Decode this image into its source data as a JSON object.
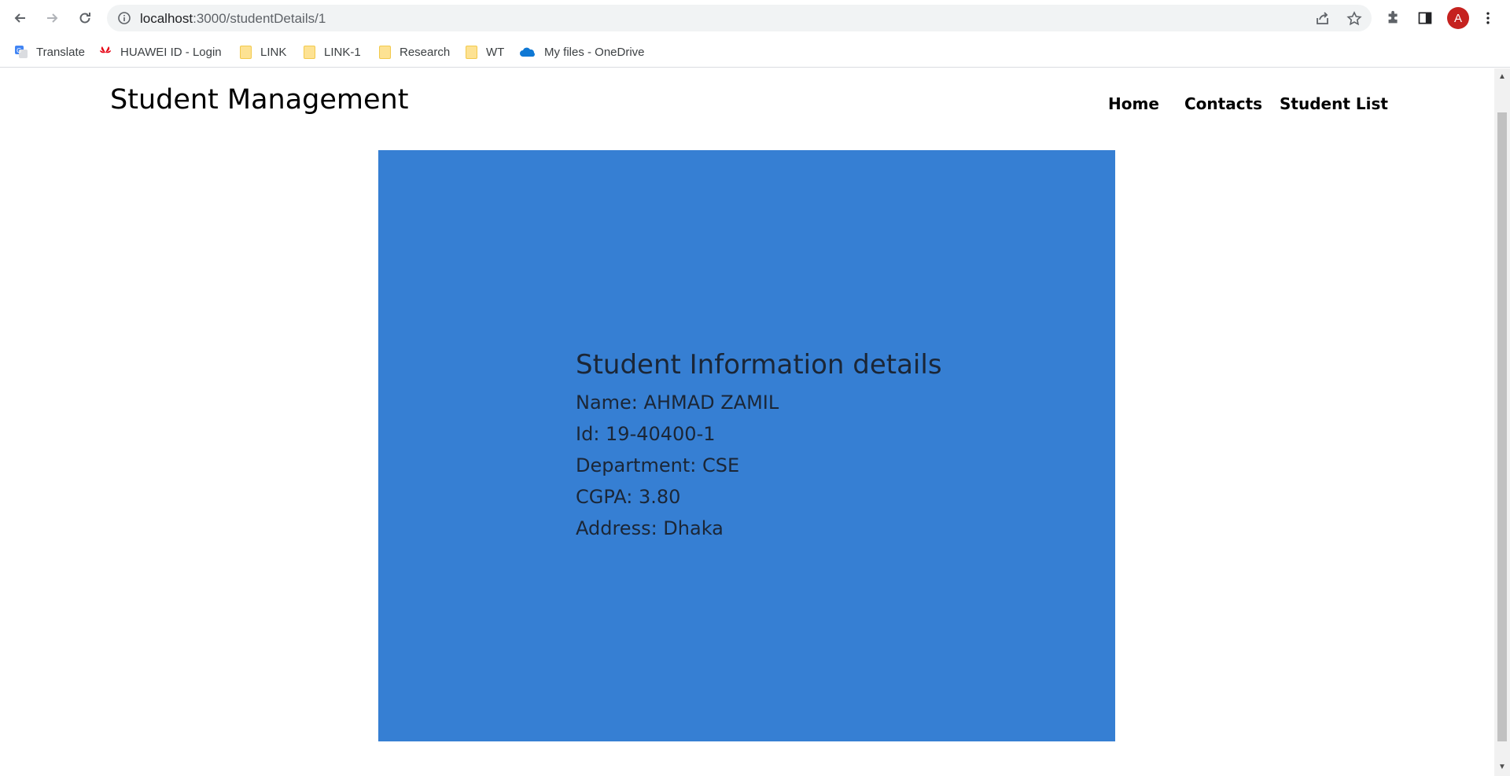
{
  "browser": {
    "url_host": "localhost",
    "url_path": ":3000/studentDetails/1",
    "profile_initial": "A",
    "icons": {
      "back": "arrow-left-icon",
      "forward": "arrow-right-icon",
      "reload": "reload-icon",
      "info": "info-icon",
      "share": "share-icon",
      "bookmark": "star-icon",
      "extensions": "puzzle-icon",
      "side_panel": "side-panel-icon",
      "menu": "kebab-menu-icon"
    }
  },
  "bookmarks": [
    {
      "label": "Translate",
      "icon": "google-translate-icon"
    },
    {
      "label": "HUAWEI ID - Login",
      "icon": "huawei-icon"
    },
    {
      "label": "LINK",
      "icon": "folder-icon"
    },
    {
      "label": "LINK-1",
      "icon": "folder-icon"
    },
    {
      "label": "Research",
      "icon": "folder-icon"
    },
    {
      "label": "WT",
      "icon": "folder-icon"
    },
    {
      "label": "My files - OneDrive",
      "icon": "onedrive-icon"
    }
  ],
  "site": {
    "title": "Student Management",
    "nav": [
      "Home",
      "Contacts",
      "Student List"
    ]
  },
  "student": {
    "heading": "Student Information details",
    "name": "Name: AHMAD ZAMIL",
    "id": "Id: 19-40400-1",
    "department": "Department: CSE",
    "cgpa": "CGPA: 3.80",
    "address": "Address: Dhaka"
  },
  "colors": {
    "card_background": "#367fd3",
    "info_text": "#1b2636",
    "avatar": "#c5221f"
  }
}
